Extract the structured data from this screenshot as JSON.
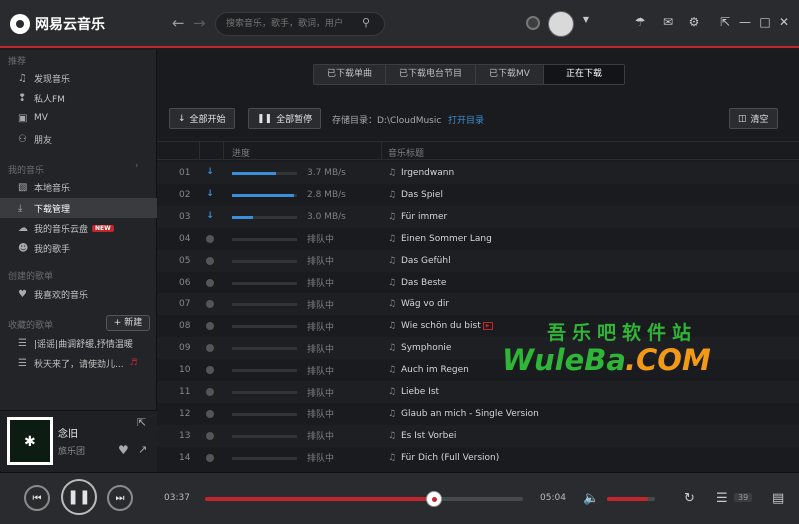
{
  "app": {
    "name": "网易云音乐"
  },
  "header": {
    "search_placeholder": "搜索音乐，歌手，歌词，用户"
  },
  "sidebar": {
    "section_recommend": "推荐",
    "recommend_items": [
      {
        "label": "发现音乐",
        "icon": "music-note-icon"
      },
      {
        "label": "私人FM",
        "icon": "radio-icon"
      },
      {
        "label": "MV",
        "icon": "tv-icon"
      },
      {
        "label": "朋友",
        "icon": "friends-icon"
      }
    ],
    "section_mymusic": "我的音乐",
    "mymusic_items": [
      {
        "label": "本地音乐",
        "icon": "monitor-icon"
      },
      {
        "label": "下载管理",
        "icon": "download-icon"
      },
      {
        "label": "我的音乐云盘",
        "icon": "cloud-icon",
        "badge": "NEW"
      },
      {
        "label": "我的歌手",
        "icon": "person-icon"
      }
    ],
    "section_created": "创建的歌单",
    "new_button": "+ 新建",
    "created_items": [
      {
        "label": "我喜欢的音乐",
        "icon": "heart-icon"
      }
    ],
    "section_collected": "收藏的歌单",
    "collected_items": [
      {
        "label": "|谣谣|曲调舒缓,抒情温暖",
        "icon": "playlist-icon"
      },
      {
        "label": "秋天来了，请使劲儿...",
        "icon": "playlist-icon"
      }
    ]
  },
  "now_playing": {
    "song": "念旧",
    "artist": "旅乐团"
  },
  "tabs": [
    "已下载单曲",
    "已下载电台节目",
    "已下载MV",
    "正在下载"
  ],
  "toolbar": {
    "start_all": "全部开始",
    "pause_all": "全部暂停",
    "dir_label": "存储目录：D:\\CloudMusic",
    "open_dir": "打开目录",
    "clear": "清空"
  },
  "list": {
    "headers": {
      "progress": "进度",
      "title": "音乐标题"
    },
    "rows": [
      {
        "num": "01",
        "status": "downloading",
        "progress": 0.68,
        "speed": "3.7 MB/s",
        "title": "Irgendwann"
      },
      {
        "num": "02",
        "status": "downloading",
        "progress": 0.95,
        "speed": "2.8 MB/s",
        "title": "Das Spiel"
      },
      {
        "num": "03",
        "status": "downloading",
        "progress": 0.33,
        "speed": "3.0 MB/s",
        "title": "Für immer"
      },
      {
        "num": "04",
        "status": "waiting",
        "speed": "排队中",
        "title": "Einen Sommer Lang"
      },
      {
        "num": "05",
        "status": "waiting",
        "speed": "排队中",
        "title": "Das Gefühl"
      },
      {
        "num": "06",
        "status": "waiting",
        "speed": "排队中",
        "title": "Das Beste"
      },
      {
        "num": "07",
        "status": "waiting",
        "speed": "排队中",
        "title": "Wäg vo dir"
      },
      {
        "num": "08",
        "status": "waiting",
        "speed": "排队中",
        "title": "Wie schön du bist",
        "mv": true
      },
      {
        "num": "09",
        "status": "waiting",
        "speed": "排队中",
        "title": "Symphonie"
      },
      {
        "num": "10",
        "status": "waiting",
        "speed": "排队中",
        "title": "Auch im Regen"
      },
      {
        "num": "11",
        "status": "waiting",
        "speed": "排队中",
        "title": "Liebe Ist"
      },
      {
        "num": "12",
        "status": "waiting",
        "speed": "排队中",
        "title": "Glaub an mich - Single Version"
      },
      {
        "num": "13",
        "status": "waiting",
        "speed": "排队中",
        "title": "Es Ist Vorbei"
      },
      {
        "num": "14",
        "status": "waiting",
        "speed": "排队中",
        "title": "Für Dich (Full Version)"
      }
    ]
  },
  "watermark": {
    "cn": "吾乐吧软件站",
    "en_a": "WuleBa",
    "en_b": ".COM"
  },
  "player": {
    "current_time": "03:37",
    "total_time": "05:04",
    "progress": 0.72,
    "volume": 0.85,
    "playlist_count": "39",
    "accent": "#c0262c"
  }
}
